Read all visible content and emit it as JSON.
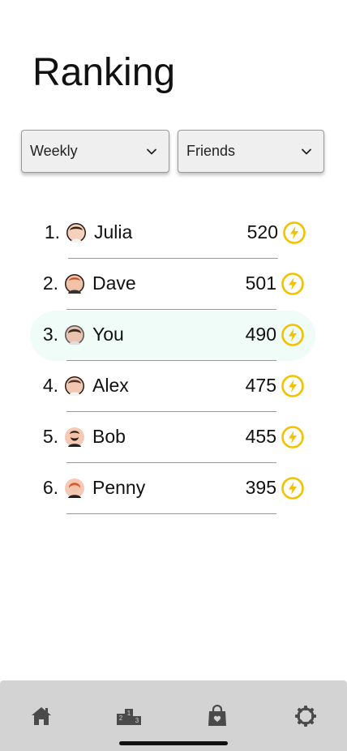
{
  "header": {
    "title": "Ranking"
  },
  "filters": {
    "period": {
      "selected": "Weekly"
    },
    "scope": {
      "selected": "Friends"
    }
  },
  "ranking": [
    {
      "position": "1.",
      "name": "Julia",
      "score": "520",
      "avatar": "avatar-woman-icon",
      "highlighted": false
    },
    {
      "position": "2.",
      "name": "Dave",
      "score": "501",
      "avatar": "avatar-man-redhair-icon",
      "highlighted": false
    },
    {
      "position": "3.",
      "name": "You",
      "score": "490",
      "avatar": "avatar-person-icon",
      "highlighted": true
    },
    {
      "position": "4.",
      "name": "Alex",
      "score": "475",
      "avatar": "avatar-woman-icon",
      "highlighted": false
    },
    {
      "position": "5.",
      "name": "Bob",
      "score": "455",
      "avatar": "avatar-man-beard-icon",
      "highlighted": false
    },
    {
      "position": "6.",
      "name": "Penny",
      "score": "395",
      "avatar": "avatar-woman-redhair-icon",
      "highlighted": false
    }
  ],
  "score_icon": "lightning-bolt-icon",
  "nav": {
    "items": [
      {
        "icon": "home-icon"
      },
      {
        "icon": "podium-icon"
      },
      {
        "icon": "shopping-bag-heart-icon"
      },
      {
        "icon": "gear-icon"
      }
    ]
  },
  "colors": {
    "accent": "#f2c200",
    "highlight": "#effcf8",
    "navbar": "#d3d3d3",
    "nav_icon": "#4a4a4a"
  }
}
